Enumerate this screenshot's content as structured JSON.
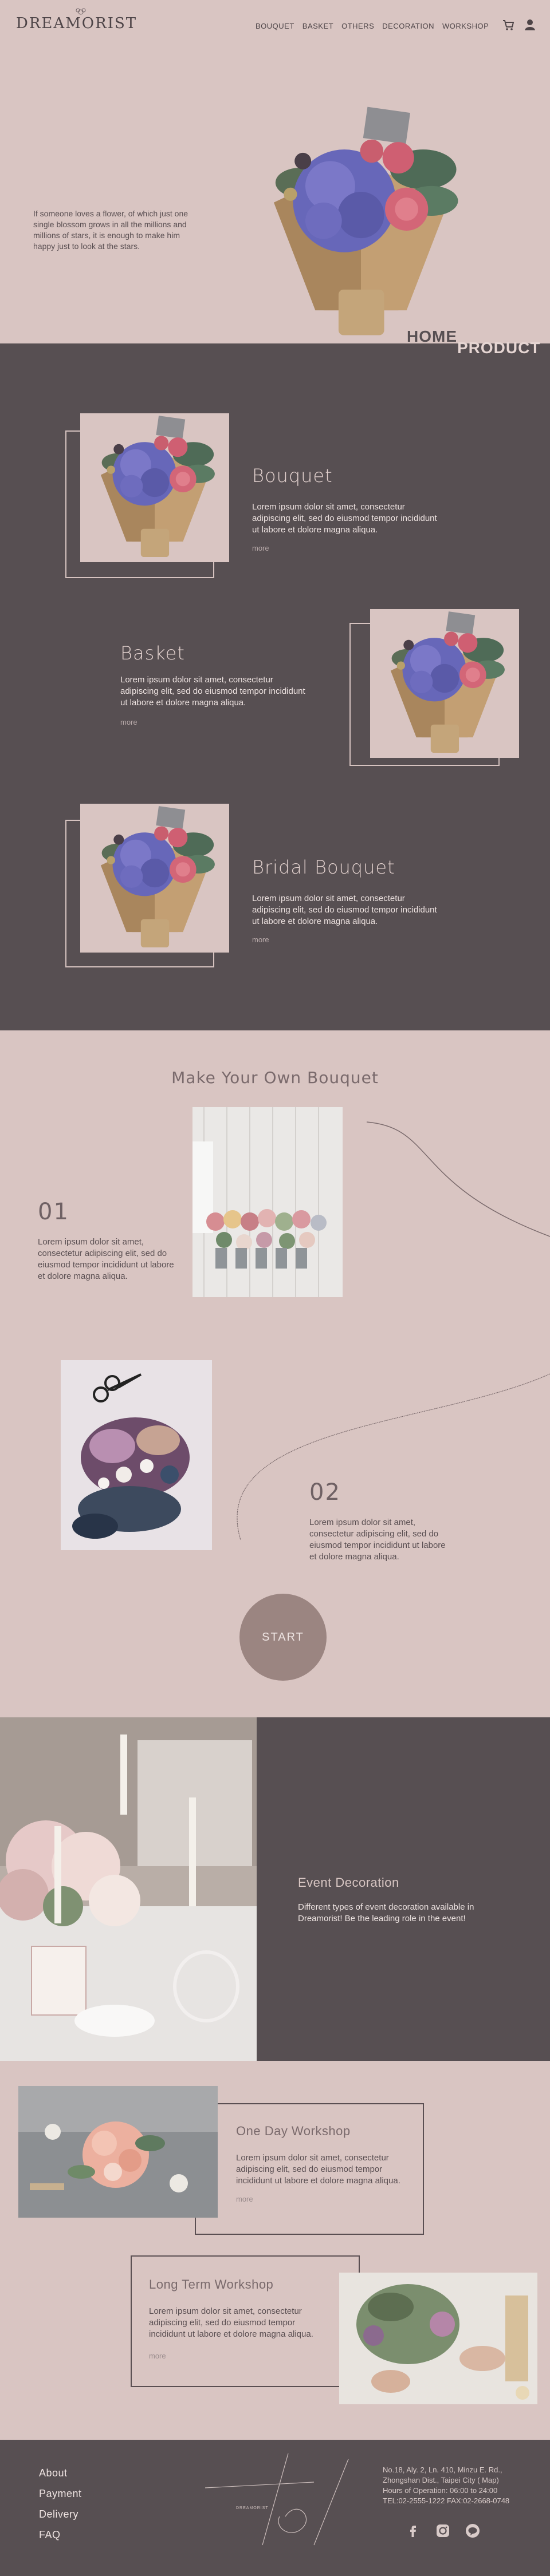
{
  "header": {
    "logo": "DREAMORIST",
    "nav": [
      "BOUQUET",
      "BASKET",
      "OTHERS",
      "DECORATION",
      "WORKSHOP"
    ],
    "icons": [
      "cart-icon",
      "user-icon"
    ]
  },
  "hero": {
    "text": "If someone loves a flower, of which just one single blossom grows in all the millions and millions of stars, it is enough to make him happy just to look at the stars.",
    "breadcrumb": {
      "home": "HOME",
      "product": "PRODUCT"
    }
  },
  "products": [
    {
      "title": "Bouquet",
      "desc": "Lorem ipsum dolor sit amet, consectetur adipiscing elit, sed do eiusmod tempor incididunt ut labore et dolore magna aliqua.",
      "more": "more"
    },
    {
      "title": "Basket",
      "desc": "Lorem ipsum dolor sit amet, consectetur adipiscing elit, sed do eiusmod tempor incididunt ut labore et dolore magna aliqua.",
      "more": "more"
    },
    {
      "title": "Bridal Bouquet",
      "desc": "Lorem ipsum dolor sit amet, consectetur adipiscing elit, sed do eiusmod tempor incididunt ut labore et dolore magna aliqua.",
      "more": "more"
    }
  ],
  "make_own": {
    "title": "Make Your Own Bouquet",
    "steps": [
      {
        "num": "01",
        "desc": "Lorem ipsum dolor sit amet, consectetur adipiscing elit, sed do eiusmod tempor incididunt ut labore et dolore magna aliqua."
      },
      {
        "num": "02",
        "desc": "Lorem ipsum dolor sit amet, consectetur adipiscing elit, sed do eiusmod tempor incididunt ut labore et dolore magna aliqua."
      }
    ],
    "start": "START"
  },
  "event": {
    "title": "Event Decoration",
    "desc": "Different types of event decoration available in Dreamorist! Be the leading role in the event!"
  },
  "workshops": [
    {
      "title": "One Day Workshop",
      "desc": "Lorem ipsum dolor sit amet, consectetur adipiscing elit, sed do eiusmod tempor incididunt ut labore et dolore magna aliqua.",
      "more": "more"
    },
    {
      "title": "Long Term Workshop",
      "desc": "Lorem ipsum dolor sit amet, consectetur adipiscing elit, sed do eiusmod tempor incididunt ut labore et dolore magna aliqua.",
      "more": "more"
    }
  ],
  "footer": {
    "links": [
      "About",
      "Payment",
      "Delivery",
      "FAQ"
    ],
    "logo_text": "DREAMORIST",
    "address1": "No.18, Aly. 2, Ln. 410, Minzu E. Rd.,",
    "address2": "Zhongshan Dist., Taipei City ( Map)",
    "hours": "Hours of Operation: 06:00 to 24:00",
    "phone": "TEL:02-2555-1222 FAX:02-2668-0748",
    "social": [
      "facebook-icon",
      "instagram-icon",
      "line-icon"
    ]
  },
  "colors": {
    "background": "#d9c5c2",
    "dark": "#574f52",
    "accent": "#9b8581"
  }
}
